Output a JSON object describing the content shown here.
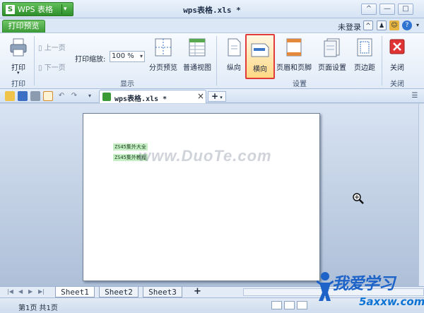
{
  "app": {
    "name": "WPS 表格",
    "document_title": "wps表格.xls *"
  },
  "window_controls": {
    "minimize": "—",
    "maximize": "□",
    "close": "✕",
    "extra": "^"
  },
  "tabs": {
    "active": "打印预览"
  },
  "header_right": {
    "login": "未登录"
  },
  "ribbon": {
    "print_label": "打印",
    "prev_page": "上一页",
    "next_page": "下一页",
    "zoom_label": "打印缩放:",
    "zoom_value": "100 %",
    "page_break_preview": "分页预览",
    "normal_view": "普通视图",
    "portrait": "纵向",
    "landscape": "横向",
    "header_footer": "页眉和页脚",
    "page_setup": "页面设置",
    "margins": "页边距",
    "close": "关闭",
    "groups": {
      "print": "打印",
      "display": "显示",
      "settings": "设置",
      "close": "关闭"
    }
  },
  "document_tab": {
    "name": "wps表格.xls *",
    "close": "×",
    "add": "+"
  },
  "page_content": {
    "cells": [
      "ZS45集外大全",
      "ZS45集外教程"
    ]
  },
  "watermark": "www.DuoTe.com",
  "sheets": [
    "Sheet1",
    "Sheet2",
    "Sheet3"
  ],
  "sheet_add": "+",
  "status": {
    "text": "第1页 共1页"
  },
  "branding": {
    "name": "我爱学习",
    "url": "5axxw.com"
  },
  "colors": {
    "ribbon_bg": "#e9f0f9",
    "accent_green": "#3a9a36",
    "highlight_border": "#e03a3a",
    "brand_blue": "#1d63c8"
  }
}
